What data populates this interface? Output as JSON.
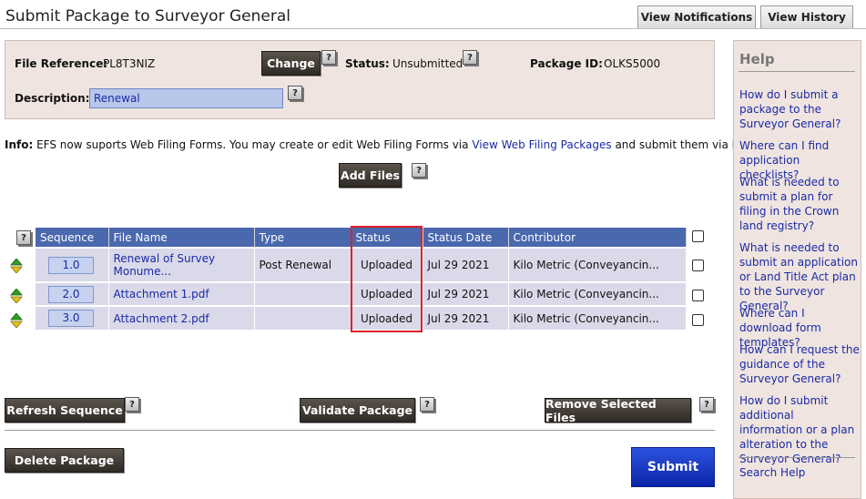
{
  "page_title": "Submit Package to Surveyor General",
  "tabs": {
    "notifications": "View Notifications",
    "history": "View History"
  },
  "header": {
    "file_reference_label": "File Reference:",
    "file_reference_value": "PL8T3NIZ",
    "change_button": "Change",
    "status_label": "Status:",
    "status_value": "Unsubmitted",
    "package_id_label": "Package ID:",
    "package_id_value": "OLKS5000",
    "description_label": "Description:",
    "description_value": "Renewal"
  },
  "info": {
    "prefix": "Info:",
    "text_before": " EFS now suports Web Filing Forms. You may create or edit Web Filing Forms via ",
    "link": "View Web Filing Packages",
    "text_after": " and submit them via EFS."
  },
  "add_files_button": "Add Files",
  "help_icon_label": "?",
  "table": {
    "headers": [
      "Sequence",
      "File Name",
      "Type",
      "Status",
      "Status Date",
      "Contributor"
    ],
    "rows": [
      {
        "sequence": "1.0",
        "file_name_line1": "Renewal of Survey",
        "file_name_line2": "Monume...",
        "type": "Post Renewal",
        "status": "Uploaded",
        "date": "Jul 29 2021",
        "contributor": "Kilo Metric (Conveyancin..."
      },
      {
        "sequence": "2.0",
        "file_name_line1": "Attachment 1.pdf",
        "file_name_line2": "",
        "type": "",
        "status": "Uploaded",
        "date": "Jul 29 2021",
        "contributor": "Kilo Metric (Conveyancin..."
      },
      {
        "sequence": "3.0",
        "file_name_line1": "Attachment 2.pdf",
        "file_name_line2": "",
        "type": "",
        "status": "Uploaded",
        "date": "Jul 29 2021",
        "contributor": "Kilo Metric (Conveyancin..."
      }
    ]
  },
  "buttons": {
    "refresh_sequence": "Refresh Sequence",
    "validate_package": "Validate Package",
    "remove_selected": "Remove Selected Files",
    "delete_package": "Delete Package",
    "submit": "Submit"
  },
  "help_panel": {
    "title": "Help",
    "links": [
      "How do I submit a package to the Surveyor General?",
      "Where can I find application checklists?",
      "What is needed to submit a plan for filing in the Crown land registry?",
      "What is needed to submit an application or Land Title Act plan to the Surveyor General?",
      "Where can I download form templates?",
      "How can I request the guidance of the Surveyor General?",
      "How do I submit additional information or a plan alteration to the Surveyor General?"
    ],
    "search": "Search Help"
  },
  "colors": {
    "table_header": "#4a68ae",
    "panel_bg": "#efe4df",
    "link": "#1a2aa6",
    "highlight": "#e01f26",
    "submit": "#1636c8"
  }
}
